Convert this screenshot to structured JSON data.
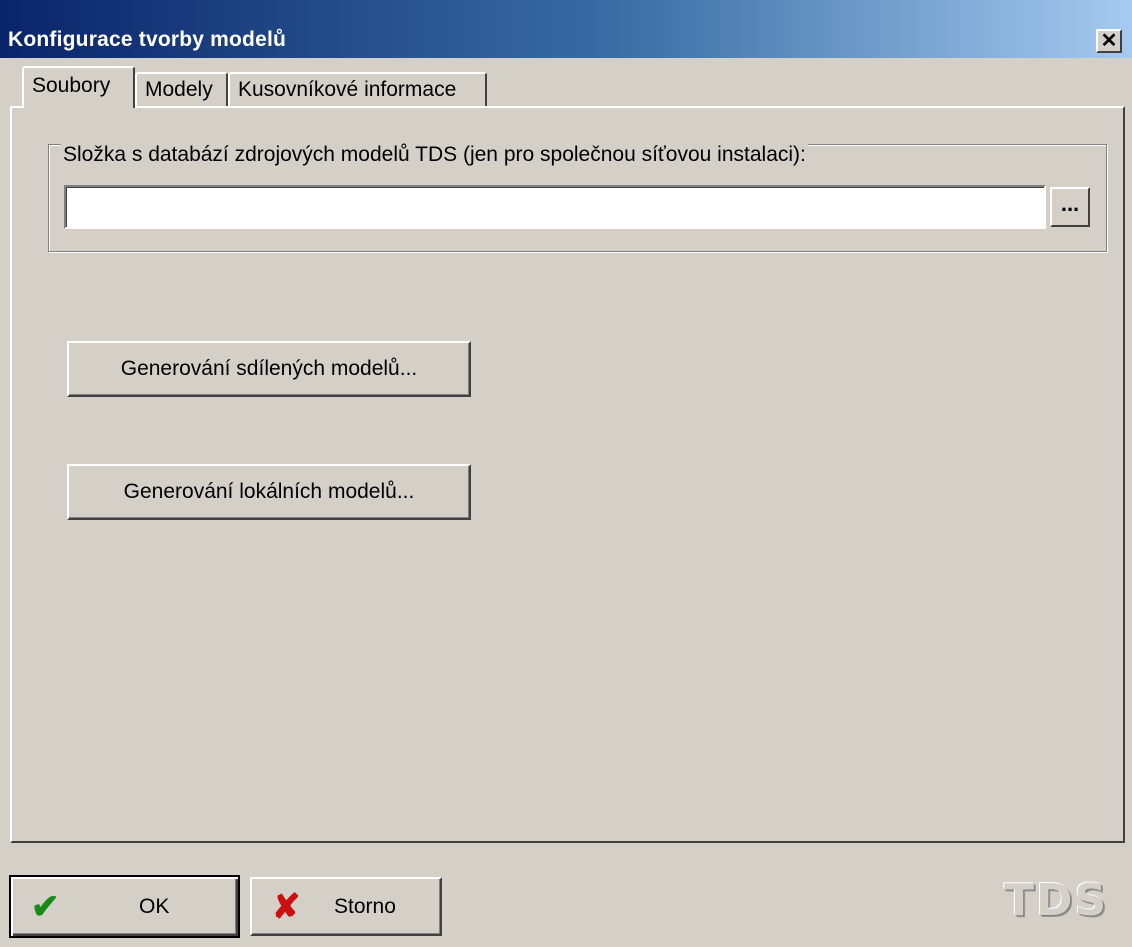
{
  "window": {
    "title": "Konfigurace tvorby modelů",
    "close_glyph": "✕"
  },
  "tabs": [
    {
      "label": "Soubory",
      "active": true
    },
    {
      "label": "Modely",
      "active": false
    },
    {
      "label": "Kusovníkové informace",
      "active": false
    }
  ],
  "files_tab": {
    "group_label": "Složka s databází zdrojových modelů TDS (jen pro společnou síťovou instalaci):",
    "path_value": "",
    "browse_label": "...",
    "generate_shared_label": "Generování sdílených modelů...",
    "generate_local_label": "Generování lokálních modelů..."
  },
  "footer": {
    "ok_label": "OK",
    "ok_icon": "checkmark-icon",
    "ok_icon_glyph": "✔",
    "cancel_label": "Storno",
    "cancel_icon": "red-x-icon",
    "cancel_icon_glyph": "✘",
    "logo_text": "TDS"
  },
  "colors": {
    "title_gradient_start": "#0a246a",
    "title_gradient_end": "#a6caf0",
    "dialog_face": "#d4d0c8",
    "ok_icon": "#168c16",
    "cancel_icon": "#cc1010"
  }
}
